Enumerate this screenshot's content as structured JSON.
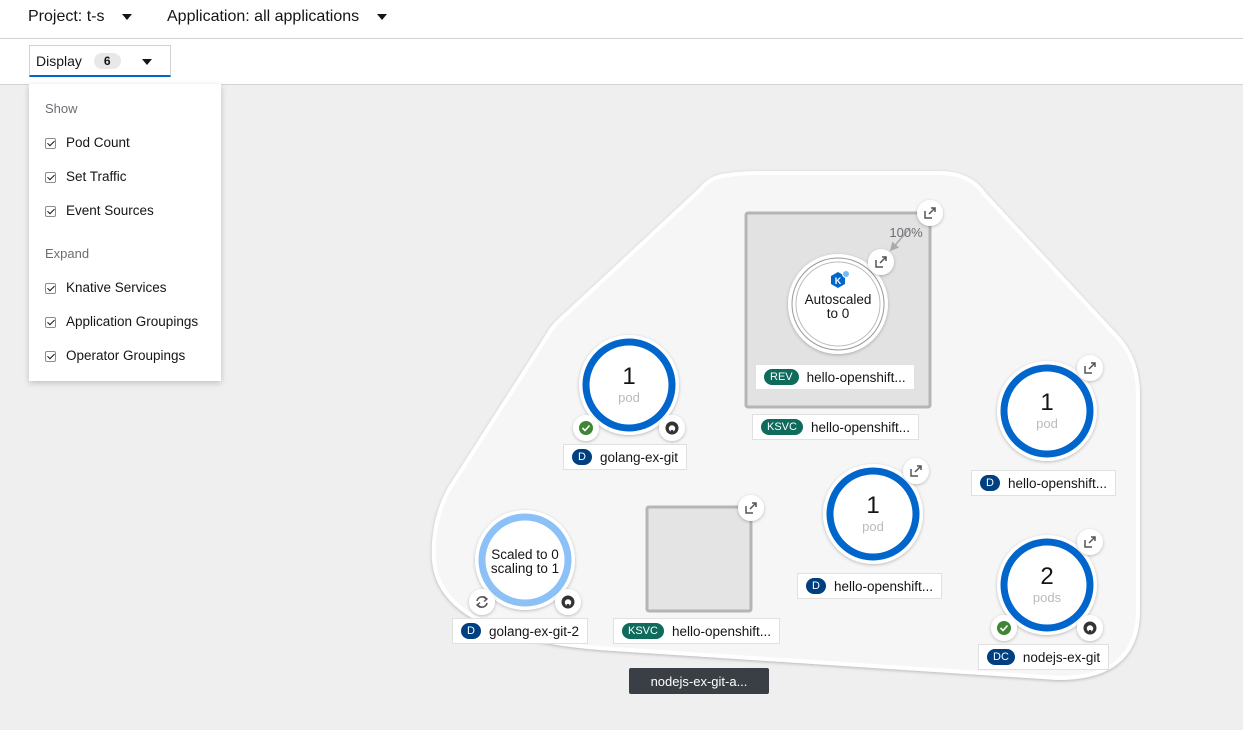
{
  "header": {
    "project_label": "Project: t-s",
    "application_label": "Application: all applications"
  },
  "toolbar": {
    "display_label": "Display",
    "display_count": "6"
  },
  "display_menu": {
    "show_heading": "Show",
    "show_items": [
      {
        "label": "Pod Count",
        "checked": true
      },
      {
        "label": "Set Traffic",
        "checked": true
      },
      {
        "label": "Event Sources",
        "checked": true
      }
    ],
    "expand_heading": "Expand",
    "expand_items": [
      {
        "label": "Knative Services",
        "checked": true
      },
      {
        "label": "Application Groupings",
        "checked": true
      },
      {
        "label": "Operator Groupings",
        "checked": true
      }
    ]
  },
  "topology": {
    "colors": {
      "pod_ring": "#0066cc",
      "scaling_ring": "#8bc1f7",
      "healthy": "#3e8635",
      "canvas": "#efefef"
    },
    "knative_service": {
      "traffic_percent": "100%",
      "revision_status": "Autoscaled",
      "revision_status_2": "to 0",
      "revision_badge": "REV",
      "revision_name": "hello-openshift...",
      "service_badge": "KSVC",
      "service_name": "hello-openshift..."
    },
    "nodes": [
      {
        "id": "golang-ex-git",
        "pods": "1",
        "pod_word": "pod",
        "badge": "D",
        "name": "golang-ex-git",
        "status": "healthy",
        "icons": [
          "check-icon",
          "github-icon"
        ]
      },
      {
        "id": "hello-openshift-right",
        "pods": "1",
        "pod_word": "pod",
        "badge": "D",
        "name": "hello-openshift...",
        "icons": [
          "external-link-icon"
        ]
      },
      {
        "id": "hello-openshift-middle",
        "pods": "1",
        "pod_word": "pod",
        "badge": "D",
        "name": "hello-openshift...",
        "icons": [
          "external-link-icon"
        ]
      },
      {
        "id": "nodejs-ex-git",
        "pods": "2",
        "pod_word": "pods",
        "badge": "DC",
        "name": "nodejs-ex-git",
        "status": "healthy",
        "icons": [
          "check-icon",
          "github-icon",
          "external-link-icon"
        ]
      },
      {
        "id": "golang-ex-git-2",
        "status_line1": "Scaled to 0",
        "status_line2": "scaling to 1",
        "badge": "D",
        "name": "golang-ex-git-2",
        "icons": [
          "sync-icon",
          "github-icon"
        ]
      },
      {
        "id": "ksvc-empty",
        "badge": "KSVC",
        "name": "hello-openshift...",
        "icons": [
          "external-link-icon"
        ]
      }
    ],
    "group_label": "nodejs-ex-git-a..."
  }
}
